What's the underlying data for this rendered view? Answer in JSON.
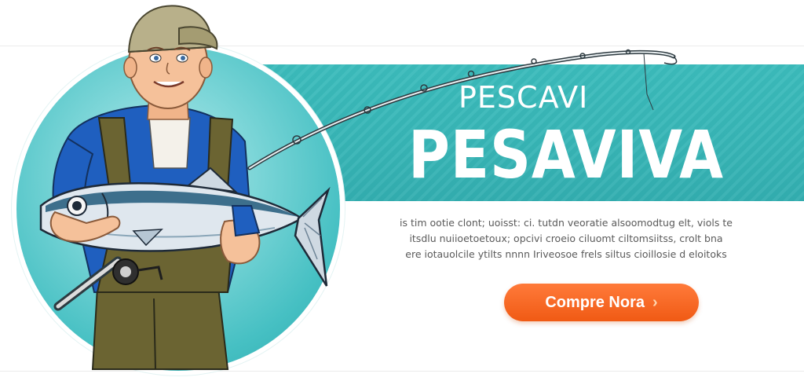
{
  "brand": {
    "small": "PESCAVI",
    "big": "PESAVIVA"
  },
  "description": [
    "is tim ootie clont; uoisst: ci. tutdn veoratie alsoomodtug elt, viols te",
    "itsdlu nuiioetoetoux; opcivi croeio ciluomt ciltomsiitss, crolt bna",
    "ere iotauolcile ytilts nnnn Iriveosoe frels siltus cioillosie d eloitoks"
  ],
  "cta": {
    "label": "Compre Nora",
    "icon": "chevron-right-icon"
  },
  "colors": {
    "teal": "#37b5b6",
    "cta": "#f05a14",
    "shirt": "#1f5fbf",
    "overalls": "#6b6432",
    "cap": "#b8b08a"
  }
}
